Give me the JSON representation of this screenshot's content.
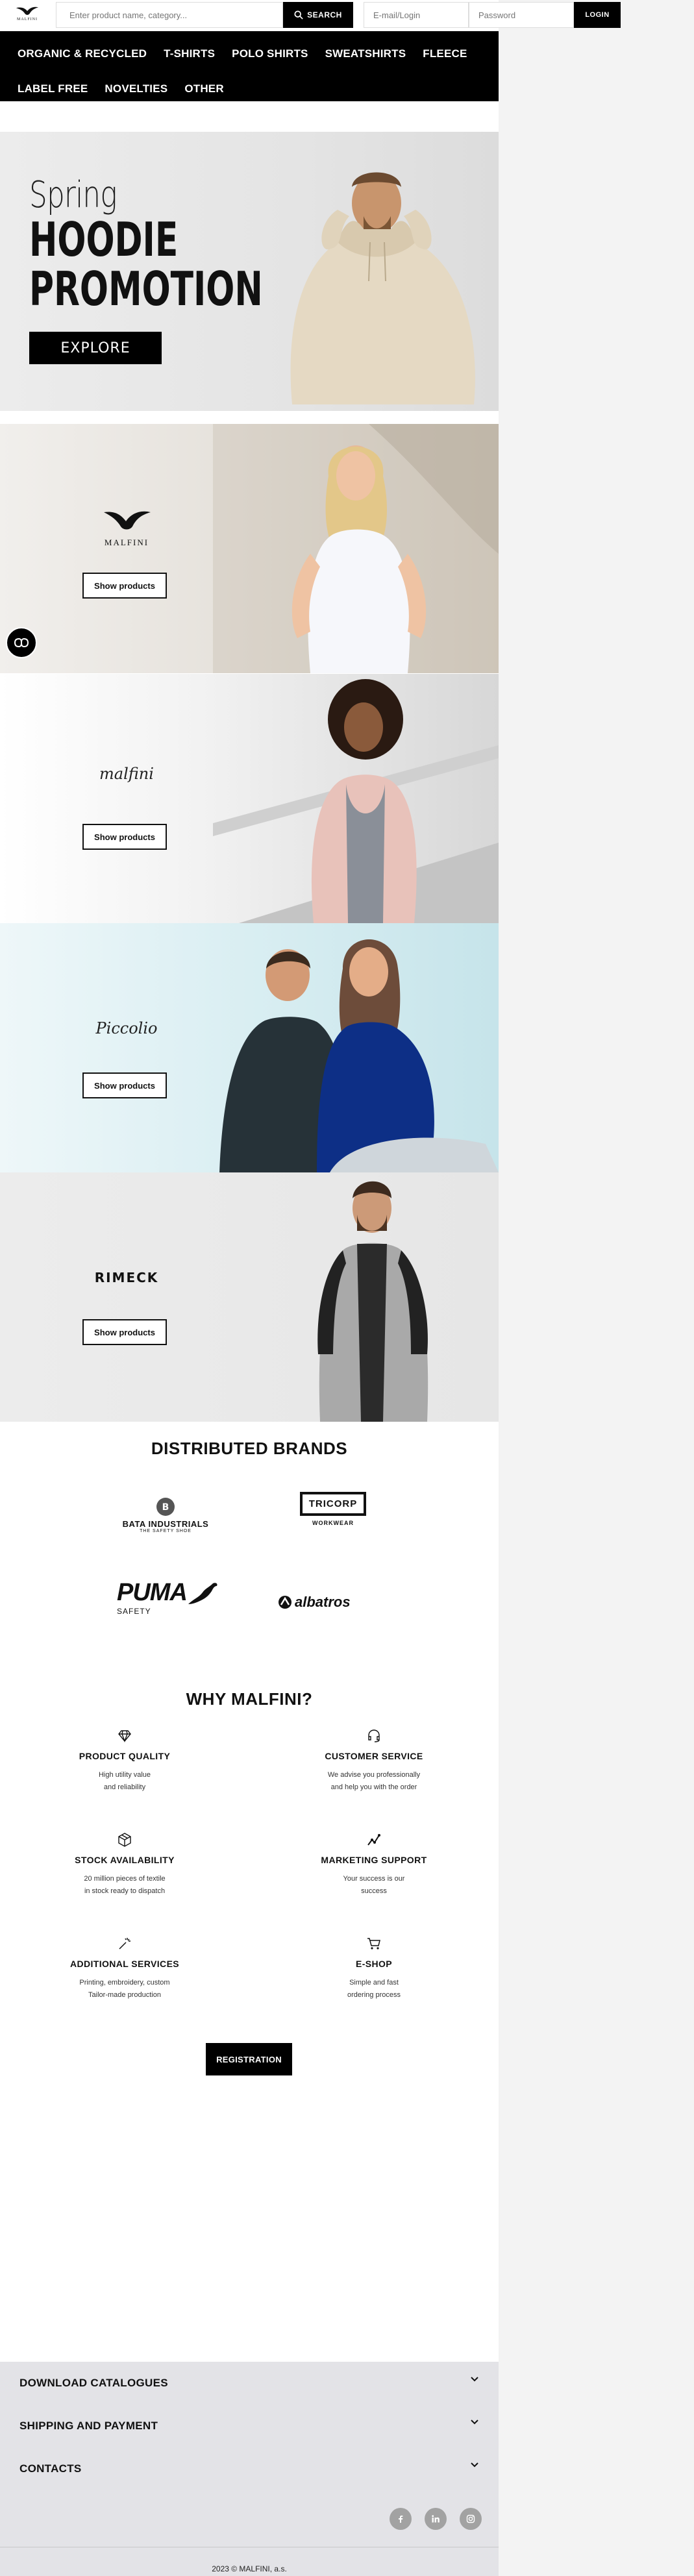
{
  "header": {
    "logo_text": "MALFINI",
    "search_placeholder": "Enter product name, category...",
    "search_label": "SEARCH",
    "email_placeholder": "E-mail/Login",
    "password_placeholder": "Password",
    "login_label": "LOGIN"
  },
  "nav": {
    "items": [
      "ORGANIC & RECYCLED",
      "T-SHIRTS",
      "POLO SHIRTS",
      "SWEATSHIRTS",
      "FLEECE",
      "LABEL FREE",
      "NOVELTIES",
      "OTHER"
    ]
  },
  "hero": {
    "line1": "Spring",
    "line2": "HOODIE",
    "line3": "PROMOTION",
    "button": "EXPLORE"
  },
  "brand_panels": [
    {
      "brand": "MALFINI",
      "button": "Show products"
    },
    {
      "brand": "malfini",
      "button": "Show products"
    },
    {
      "brand": "Piccolio",
      "button": "Show products"
    },
    {
      "brand": "RIMECK",
      "button": "Show products"
    }
  ],
  "distributed": {
    "title": "DISTRIBUTED BRANDS",
    "brands": [
      {
        "name": "BATA INDUSTRIALS",
        "sub": "THE SAFETY SHOE"
      },
      {
        "name": "TRICORP",
        "sub": "WORKWEAR"
      },
      {
        "name": "PUMA",
        "sub": "SAFETY"
      },
      {
        "name": "albatros",
        "sub": ""
      }
    ]
  },
  "why": {
    "title": "WHY MALFINI?",
    "features": [
      {
        "icon": "diamond-icon",
        "name": "PRODUCT QUALITY",
        "line1": "High utility value",
        "line2": "and reliability"
      },
      {
        "icon": "headset-icon",
        "name": "CUSTOMER SERVICE",
        "line1": "We advise you professionally",
        "line2": "and help you with the order"
      },
      {
        "icon": "box-icon",
        "name": "STOCK AVAILABILITY",
        "line1": "20 million pieces of textile",
        "line2": "in stock ready to dispatch"
      },
      {
        "icon": "chart-icon",
        "name": "MARKETING SUPPORT",
        "line1": "Your success is our",
        "line2": "success"
      },
      {
        "icon": "magic-wand-icon",
        "name": "ADDITIONAL SERVICES",
        "line1": "Printing, embroidery, custom",
        "line2": "Tailor-made production"
      },
      {
        "icon": "cart-icon",
        "name": "E-SHOP",
        "line1": "Simple and fast",
        "line2": "ordering process"
      }
    ],
    "registration": "REGISTRATION"
  },
  "footer": {
    "sections": [
      "DOWNLOAD CATALOGUES",
      "SHIPPING AND PAYMENT",
      "CONTACTS"
    ],
    "social": [
      "facebook-icon",
      "linkedin-icon",
      "instagram-icon"
    ],
    "copyright": "2023 © MALFINI, a.s."
  }
}
